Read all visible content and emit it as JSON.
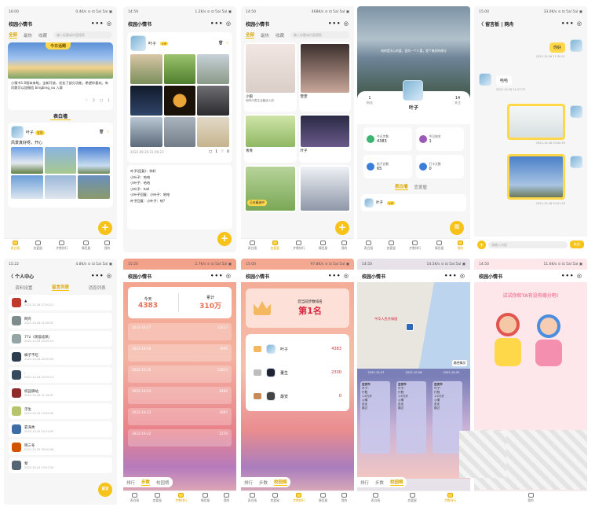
{
  "app": {
    "title": "校园小情书",
    "controls": "••• ◎"
  },
  "colors": {
    "accent": "#f7c21a",
    "accent_dark": "#d9a800",
    "sunset_top": "#f2a38c",
    "sunset_bottom": "#f7c6b8",
    "map_water": "#bcd4ee",
    "pink_bg": "#fde7ea"
  },
  "icons": {
    "menu": "more-dots-icon",
    "target": "target-icon",
    "heart": "heart-icon",
    "comment": "comment-icon",
    "plus": "plus-icon",
    "back": "back-arrow-icon",
    "trash": "trash-icon",
    "star": "star-icon"
  },
  "nav": {
    "items": [
      "表白墙",
      "恋爱屋",
      "步数排行",
      "情侣屋",
      "我的"
    ]
  },
  "s1": {
    "status": "16:00",
    "status_r": "0.4K/s ⊙ ⊡ 5al 5al ▣",
    "tabs": [
      "全部",
      "最热",
      "收藏"
    ],
    "search_ph": "输入标题或内容搜索",
    "banner": "今日话题",
    "topic_text": "小情书1.0版本来啦，全新开放，优化了部分功能，希望你喜欢。有问题可以加微信 bingbing_ou 入群",
    "likes": "2",
    "comments": "1",
    "section": "表白墙",
    "user": "叶子",
    "tag": "宝塔",
    "post_text": "风景真好呀，开心"
  },
  "s2": {
    "status": "14:59",
    "status_r": "1.2K/s ⊙ ⊡ 5al 5al ▣",
    "user": "叶子",
    "time": "2022-09-26 21:09:23",
    "comments": "1",
    "likes": "0",
    "c1": "叶子(回复)：你好",
    "c2": "小叶子：哈哈",
    "c3": "小叶子：哈哈",
    "c4": "小叶子：hall",
    "c5": "小叶子回复：小叶子：哈哈",
    "c6": "叶子回复：小叶子：哈?"
  },
  "s3": {
    "status": "14:50",
    "status_r": "468K/s ⊙ ⊡ 5al 5al ▣",
    "tabs": [
      "全部",
      "最热",
      "收藏"
    ],
    "search_ph": "输入标题或内容搜索",
    "n1": "小狼",
    "n2": "雯雯",
    "n3": "青青",
    "n4": "叶子",
    "d1": "他吗代表生活最迷人的",
    "badge": "正在精选中"
  },
  "s4": {
    "followers": "1",
    "followers_label": "粉丝",
    "following": "14",
    "following_label": "关注",
    "name": "叶子",
    "stats": [
      {
        "label": "今日步数",
        "value": "4383"
      },
      {
        "label": "今日排名",
        "value": "1"
      },
      {
        "label": "帖子总数",
        "value": "65"
      },
      {
        "label": "打卡天数",
        "value": "0"
      }
    ],
    "tabs": [
      "表白墙",
      "恋爱屋"
    ],
    "quote": "给的是天心的爱，因为一个人爱，是个美好的缘分"
  },
  "s5": {
    "status": "15:00",
    "status_r": "33.0K/s ⊙ ⊡ 5al 5al ▣",
    "title": "留言板 | 网舟",
    "hello": "你好",
    "time1": "2022-10-26 17:30:21",
    "haha": "哈哈",
    "time2": "2022-10-26 21:07:37",
    "time3": "2022-10-26 20:00:55",
    "time4": "2022-10-26 20:01:59",
    "input_ph": "请输入内容",
    "send": "发送"
  },
  "s6": {
    "status": "15:22",
    "status_r": "4.8K/s ⊙ ⊡ 5al 5al ▣",
    "title": "个人中心",
    "tabs": [
      "资料设置",
      "留言列表",
      "消息列表"
    ],
    "items": [
      {
        "name": "▲",
        "date": "2022-10-26 17:30:21"
      },
      {
        "name": "网舟",
        "date": "2022-10-26 21:08:31"
      },
      {
        "name": "77z（颂猫炫佩）",
        "date": "2022-10-26 10:45:11"
      },
      {
        "name": "橘子不吃",
        "date": "2022-10-26 20:00:55"
      },
      {
        "name": "·",
        "date": "2022-10-26 20:05:13"
      },
      {
        "name": "校园驿站",
        "date": "2022-10-26 21:18:47"
      },
      {
        "name": "浮生",
        "date": "2022-10-25 13:05:55"
      },
      {
        "name": "靠海秀",
        "date": "2022-10-25 12:24:50"
      },
      {
        "name": "晓三冬",
        "date": "2022-10-25 09:50:06"
      },
      {
        "name": "黎",
        "date": "2022-10-24 13:07:29"
      }
    ],
    "fab": "留言"
  },
  "s7": {
    "status": "15:20",
    "status_r": "2.7K/s ⊙ ⊡ 5al 5al ▣",
    "today_label": "今天",
    "today": "4383",
    "total_label": "累计",
    "total": "310万",
    "rows": [
      {
        "date": "2022-10-27",
        "steps": "13227"
      },
      {
        "date": "2022-10-26",
        "steps": "7495"
      },
      {
        "date": "2022-10-25",
        "steps": "12813"
      },
      {
        "date": "2022-10-24",
        "steps": "8160"
      },
      {
        "date": "2022-10-23",
        "steps": "2687"
      },
      {
        "date": "2022-10-22",
        "steps": "2270"
      }
    ],
    "tabs": [
      "排行",
      "步数",
      "校园榜"
    ]
  },
  "s8": {
    "status": "15:00",
    "status_r": "97.8K/s ⊙ ⊡ 5al 5al ▣",
    "rank_title": "您当前步数排名",
    "rank": "第1名",
    "rows": [
      {
        "name": "叶子",
        "steps": "4383"
      },
      {
        "name": "董生",
        "steps": "2330"
      },
      {
        "name": "最安",
        "steps": "0"
      }
    ],
    "tabs": [
      "排行",
      "步数",
      "校园榜"
    ]
  },
  "s9": {
    "status": "14:50",
    "status_r": "14.5K/s ⊙ ⊡ 5al 5al ▣",
    "map_label": "中华人民共和国",
    "footer_label": "路径情况",
    "dates": [
      "2022-10-27",
      "2022-10-26",
      "2022-10-25"
    ],
    "city": "吉安市",
    "tl_lines": [
      "叶子：",
      "行程",
      "1.6万步",
      "心情",
      "走走",
      "路过"
    ],
    "tabs": [
      "排行",
      "步数",
      "校园榜"
    ]
  },
  "s10": {
    "status": "14:50",
    "status_r": "11.6K/s ⊙ ⊡ 5al 5al ▣",
    "headline": "试试你和TA有没有缘分吧!"
  }
}
